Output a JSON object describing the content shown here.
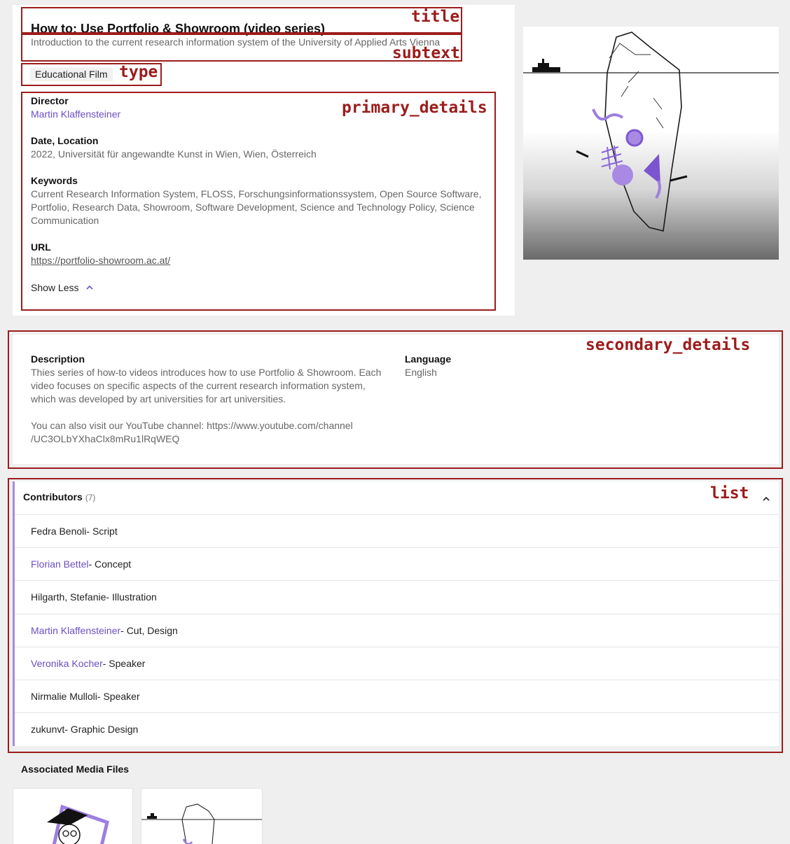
{
  "annotations": {
    "title": "title",
    "subtext": "subtext",
    "type": "type",
    "primary_details": "primary_details",
    "secondary_details": "secondary_details",
    "list": "list"
  },
  "entry": {
    "title": "How to: Use Portfolio & Showroom (video series)",
    "subtext": "Introduction to the current research information system of the University of Applied Arts Vienna",
    "type": "Educational Film"
  },
  "primary_details": {
    "director_label": "Director",
    "director_value": "Martin Klaffensteiner",
    "date_label": "Date, Location",
    "date_value": "2022, Universität für angewandte Kunst in Wien, Wien, Österreich",
    "keywords_label": "Keywords",
    "keywords_value": "Current Research Information System, FLOSS, Forschungsinformationssystem, Open Source Software, Portfolio, Research Data, Showroom, Software Development, Science and Technology Policy, Science Communication",
    "url_label": "URL",
    "url_value": "https://portfolio-showroom.ac.at/",
    "show_less": "Show Less"
  },
  "secondary_details": {
    "description_label": "Description",
    "description_p1": "Thies series of how-to videos introduces how to use Portfolio & Showroom. Each video focuses on specific aspects of the current research information system, which was developed by art universities for art universities.",
    "description_p2": "You can also visit our YouTube channel: https://www.youtube.com/channel /UC3OLbYXhaClx8mRu1lRqWEQ",
    "language_label": "Language",
    "language_value": "English"
  },
  "contributors": {
    "label": "Contributors",
    "count": "(7)",
    "items": [
      {
        "name": "Fedra Benoli",
        "role": " - Script",
        "linked": false
      },
      {
        "name": "Florian Bettel",
        "role": " - Concept",
        "linked": true
      },
      {
        "name": "Hilgarth, Stefanie",
        "role": " - Illustration",
        "linked": false
      },
      {
        "name": "Martin Klaffensteiner",
        "role": " - Cut, Design",
        "linked": true
      },
      {
        "name": "Veronika Kocher",
        "role": " - Speaker",
        "linked": true
      },
      {
        "name": "Nirmalie Mulloli",
        "role": " - Speaker",
        "linked": false
      },
      {
        "name": "zukunvt",
        "role": " - Graphic Design",
        "linked": false
      }
    ]
  },
  "media": {
    "title": "Associated Media Files"
  },
  "colors": {
    "accent": "#6c4fc4",
    "annotation": "#9c1c1c",
    "list_bar": "#a48cdb"
  }
}
